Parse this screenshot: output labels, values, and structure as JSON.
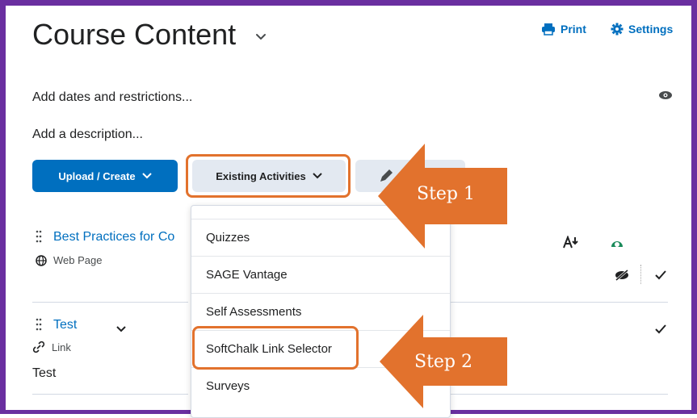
{
  "page": {
    "title": "Course Content",
    "print_label": "Print",
    "settings_label": "Settings",
    "dates_link": "Add dates and restrictions...",
    "description_link": "Add a description..."
  },
  "toolbar": {
    "upload_label": "Upload / Create",
    "existing_label": "Existing Activities"
  },
  "dropdown": {
    "items": [
      "Quizzes",
      "SAGE Vantage",
      "Self Assessments",
      "SoftChalk Link Selector",
      "Surveys"
    ]
  },
  "content_items": [
    {
      "title": "Best Practices for Co",
      "type": "Web Page"
    },
    {
      "title": "Test",
      "type": "Link",
      "description": "Test"
    }
  ],
  "annotations": {
    "step1": "Step 1",
    "step2": "Step 2"
  },
  "colors": {
    "frame": "#6a2fa0",
    "accent": "#006fbf",
    "callout": "#e2722d"
  }
}
